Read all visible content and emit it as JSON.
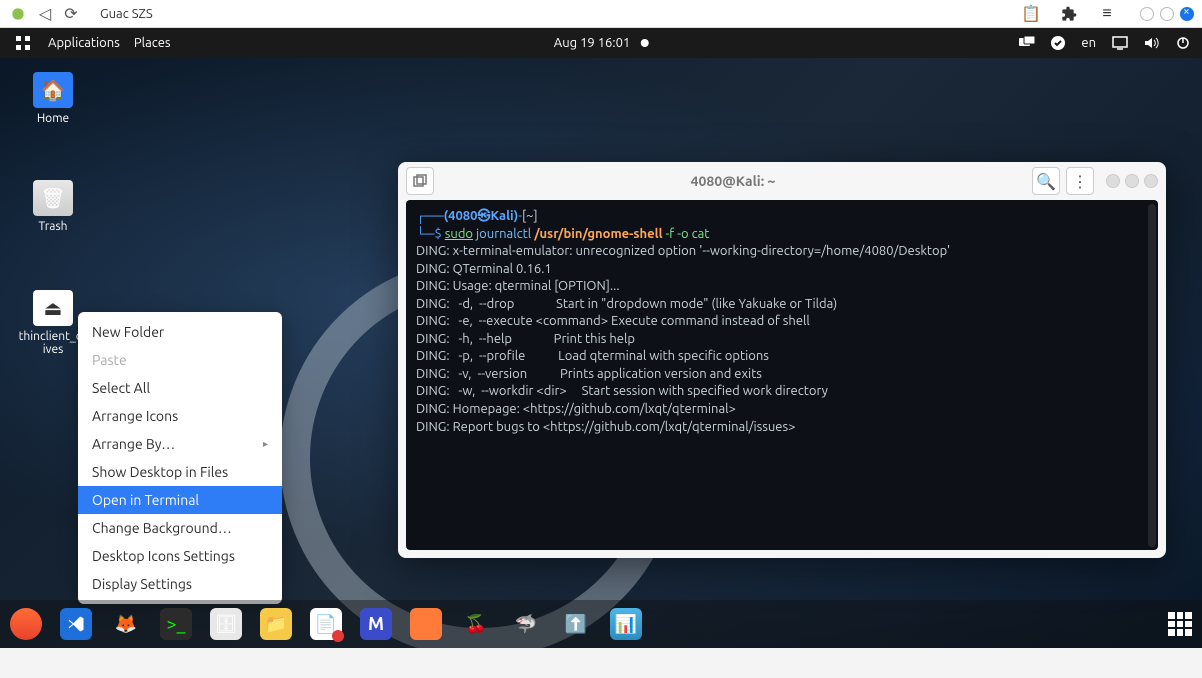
{
  "browser": {
    "tab_title": "Guac SZS"
  },
  "gnome": {
    "menu_applications": "Applications",
    "menu_places": "Places",
    "clock": "Aug 19  16:01",
    "lang": "en"
  },
  "desktop_icons": {
    "home": "Home",
    "trash": "Trash",
    "thinclient": "thinclient_drives"
  },
  "context_menu": {
    "new_folder": "New Folder",
    "paste": "Paste",
    "select_all": "Select All",
    "arrange_icons": "Arrange Icons",
    "arrange_by": "Arrange By…",
    "show_desktop": "Show Desktop in Files",
    "open_terminal": "Open in Terminal",
    "change_bg": "Change Background…",
    "icons_settings": "Desktop Icons Settings",
    "display_settings": "Display Settings"
  },
  "terminal": {
    "title": "4080@Kali: ~",
    "prompt_user": "(4080㉿Kali)",
    "prompt_path": "[~]",
    "prompt_symbol": "$",
    "cmd_sudo": "sudo",
    "cmd_journal": "journalctl",
    "cmd_path": "/usr/bin/gnome-shell",
    "cmd_flags": "-f -o cat",
    "lines": [
      "DING: x-terminal-emulator: unrecognized option '--working-directory=/home/4080/Desktop'",
      "DING: QTerminal 0.16.1",
      "DING: Usage: qterminal [OPTION]...",
      "DING:   -d,  --drop              Start in \"dropdown mode\" (like Yakuake or Tilda)",
      "DING:   -e,  --execute <command> Execute command instead of shell",
      "DING:   -h,  --help              Print this help",
      "DING:   -p,  --profile           Load qterminal with specific options",
      "DING:   -v,  --version           Prints application version and exits",
      "DING:   -w,  --workdir <dir>     Start session with specified work directory",
      "DING: Homepage: <https://github.com/lxqt/qterminal>",
      "DING: Report bugs to <https://github.com/lxqt/qterminal/issues>"
    ]
  }
}
